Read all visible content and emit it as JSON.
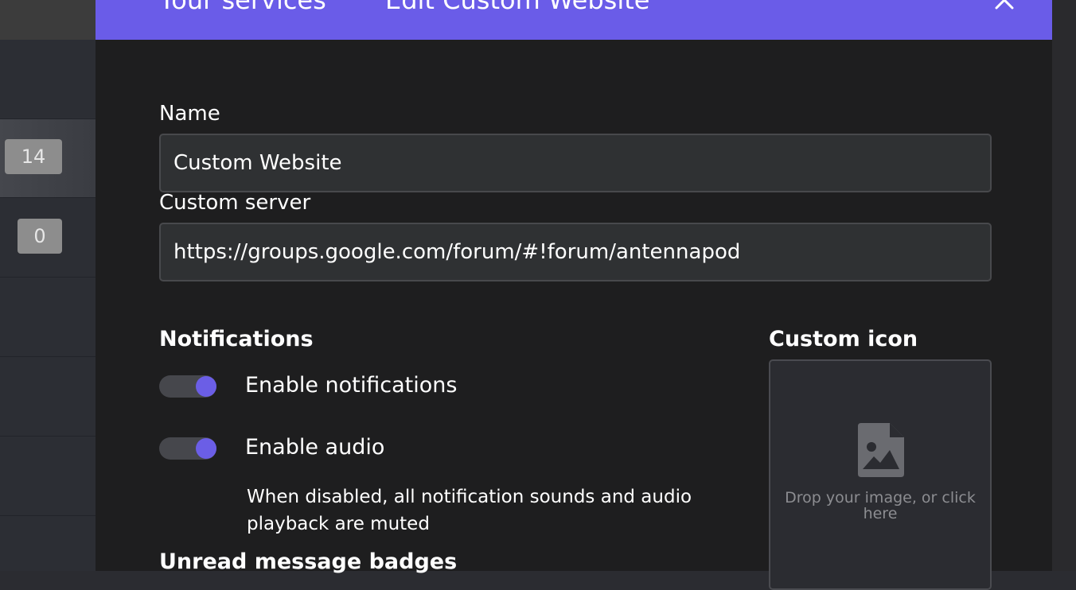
{
  "sidebar": {
    "badges": [
      "14",
      "0"
    ]
  },
  "dialog": {
    "breadcrumb": {
      "parent": "Your services",
      "current": "Edit Custom Website"
    },
    "accent_color": "#6a5ce8",
    "name_field": {
      "label": "Name",
      "value": "Custom Website"
    },
    "server_field": {
      "label": "Custom server",
      "value": "https://groups.google.com/forum/#!forum/antennapod"
    },
    "notifications": {
      "title": "Notifications",
      "enable_notifications": {
        "label": "Enable notifications",
        "checked": true
      },
      "enable_audio": {
        "label": "Enable audio",
        "checked": true
      },
      "audio_help": "When disabled, all notification sounds and audio playback are muted"
    },
    "unread_badges": {
      "title": "Unread message badges"
    },
    "custom_icon": {
      "title": "Custom icon",
      "icon": "image-icon",
      "drop_text": "Drop your image, or click here"
    }
  }
}
